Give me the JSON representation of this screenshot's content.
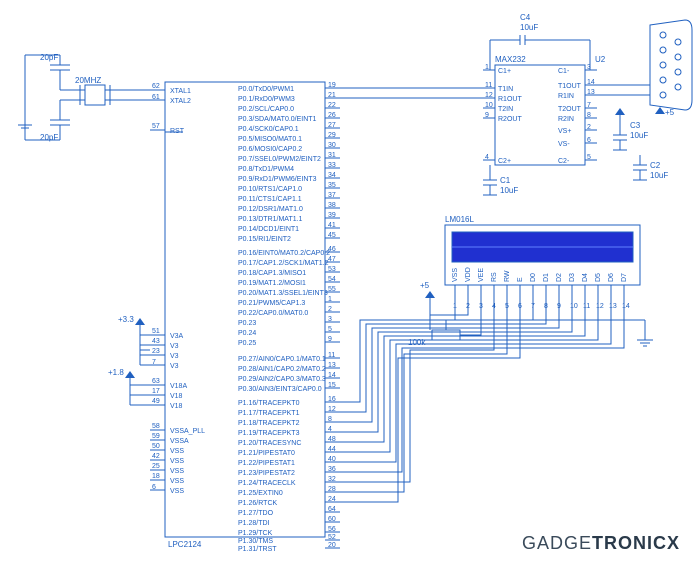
{
  "mcu": {
    "name": "LPC2124",
    "left_pins": [
      {
        "n": "62",
        "lbl": "XTAL1"
      },
      {
        "n": "61",
        "lbl": "XTAL2"
      },
      {
        "n": "57",
        "lbl": "RST"
      },
      {
        "n": "51",
        "lbl": "V3A"
      },
      {
        "n": "43",
        "lbl": "V3"
      },
      {
        "n": "23",
        "lbl": "V3"
      },
      {
        "n": "7",
        "lbl": "V3"
      },
      {
        "n": "63",
        "lbl": "V18A"
      },
      {
        "n": "17",
        "lbl": "V18"
      },
      {
        "n": "49",
        "lbl": "V18"
      },
      {
        "n": "58",
        "lbl": "VSSA_PLL"
      },
      {
        "n": "59",
        "lbl": "VSSA"
      },
      {
        "n": "50",
        "lbl": "VSS"
      },
      {
        "n": "42",
        "lbl": "VSS"
      },
      {
        "n": "25",
        "lbl": "VSS"
      },
      {
        "n": "18",
        "lbl": "VSS"
      },
      {
        "n": "6",
        "lbl": "VSS"
      }
    ],
    "right_pins": [
      {
        "n": "19",
        "lbl": "P0.0/TxD0/PWM1"
      },
      {
        "n": "21",
        "lbl": "P0.1/RxD0/PWM3"
      },
      {
        "n": "22",
        "lbl": "P0.2/SCL/CAP0.0"
      },
      {
        "n": "26",
        "lbl": "P0.3/SDA/MAT0.0/EINT1"
      },
      {
        "n": "27",
        "lbl": "P0.4/SCK0/CAP0.1"
      },
      {
        "n": "29",
        "lbl": "P0.5/MISO0/MAT0.1"
      },
      {
        "n": "30",
        "lbl": "P0.6/MOSI0/CAP0.2"
      },
      {
        "n": "31",
        "lbl": "P0.7/SSEL0/PWM2/EINT2"
      },
      {
        "n": "33",
        "lbl": "P0.8/TxD1/PWM4"
      },
      {
        "n": "34",
        "lbl": "P0.9/RxD1/PWM6/EINT3"
      },
      {
        "n": "35",
        "lbl": "P0.10/RTS1/CAP1.0"
      },
      {
        "n": "37",
        "lbl": "P0.11/CTS1/CAP1.1"
      },
      {
        "n": "38",
        "lbl": "P0.12/DSR1/MAT1.0"
      },
      {
        "n": "39",
        "lbl": "P0.13/DTR1/MAT1.1"
      },
      {
        "n": "41",
        "lbl": "P0.14/DCD1/EINT1"
      },
      {
        "n": "45",
        "lbl": "P0.15/RI1/EINT2"
      },
      {
        "n": "46",
        "lbl": "P0.16/EINT0/MAT0.2/CAP0.2"
      },
      {
        "n": "47",
        "lbl": "P0.17/CAP1.2/SCK1/MAT1.2"
      },
      {
        "n": "53",
        "lbl": "P0.18/CAP1.3/MISO1"
      },
      {
        "n": "54",
        "lbl": "P0.19/MAT1.2/MOSI1"
      },
      {
        "n": "55",
        "lbl": "P0.20/MAT1.3/SSEL1/EINT3"
      },
      {
        "n": "1",
        "lbl": "P0.21/PWM5/CAP1.3"
      },
      {
        "n": "2",
        "lbl": "P0.22/CAP0.0/MAT0.0"
      },
      {
        "n": "3",
        "lbl": "P0.23"
      },
      {
        "n": "5",
        "lbl": "P0.24"
      },
      {
        "n": "9",
        "lbl": "P0.25"
      },
      {
        "n": "11",
        "lbl": "P0.27/AIN0/CAP0.1/MAT0.1"
      },
      {
        "n": "13",
        "lbl": "P0.28/AIN1/CAP0.2/MAT0.2"
      },
      {
        "n": "14",
        "lbl": "P0.29/AIN2/CAP0.3/MAT0.3"
      },
      {
        "n": "15",
        "lbl": "P0.30/AIN3/EINT3/CAP0.0"
      },
      {
        "n": "16",
        "lbl": "P1.16/TRACEPKT0"
      },
      {
        "n": "12",
        "lbl": "P1.17/TRACEPKT1"
      },
      {
        "n": "8",
        "lbl": "P1.18/TRACEPKT2"
      },
      {
        "n": "4",
        "lbl": "P1.19/TRACEPKT3"
      },
      {
        "n": "48",
        "lbl": "P1.20/TRACESYNC"
      },
      {
        "n": "44",
        "lbl": "P1.21/PIPESTAT0"
      },
      {
        "n": "40",
        "lbl": "P1.22/PIPESTAT1"
      },
      {
        "n": "36",
        "lbl": "P1.23/PIPESTAT2"
      },
      {
        "n": "32",
        "lbl": "P1.24/TRACECLK"
      },
      {
        "n": "28",
        "lbl": "P1.25/EXTIN0"
      },
      {
        "n": "24",
        "lbl": "P1.26/RTCK"
      },
      {
        "n": "64",
        "lbl": "P1.27/TDO"
      },
      {
        "n": "60",
        "lbl": "P1.28/TDI"
      },
      {
        "n": "56",
        "lbl": "P1.29/TCK"
      },
      {
        "n": "52",
        "lbl": "P1.30/TMS"
      },
      {
        "n": "20",
        "lbl": "P1.31/TRST"
      }
    ]
  },
  "max232": {
    "name": "MAX232",
    "ref": "U2",
    "left_pins": [
      {
        "n": "1",
        "lbl": "C1+"
      },
      {
        "n": "11",
        "lbl": "T1IN"
      },
      {
        "n": "12",
        "lbl": "R1OUT"
      },
      {
        "n": "10",
        "lbl": "T2IN"
      },
      {
        "n": "9",
        "lbl": "R2OUT"
      },
      {
        "n": "4",
        "lbl": "C2+"
      }
    ],
    "right_pins": [
      {
        "n": "3",
        "lbl": "C1-"
      },
      {
        "n": "14",
        "lbl": "T1OUT"
      },
      {
        "n": "13",
        "lbl": "R1IN"
      },
      {
        "n": "7",
        "lbl": "T2OUT"
      },
      {
        "n": "8",
        "lbl": "R2IN"
      },
      {
        "n": "2",
        "lbl": "VS+"
      },
      {
        "n": "6",
        "lbl": "VS-"
      },
      {
        "n": "5",
        "lbl": "C2-"
      }
    ]
  },
  "lcd": {
    "name": "LM016L",
    "pins": [
      "VSS",
      "VDD",
      "VEE",
      "RS",
      "RW",
      "E",
      "D0",
      "D1",
      "D2",
      "D3",
      "D4",
      "D5",
      "D6",
      "D7"
    ],
    "pin_nums": [
      "1",
      "2",
      "3",
      "4",
      "5",
      "6",
      "7",
      "8",
      "9",
      "10",
      "11",
      "12",
      "13",
      "14"
    ]
  },
  "caps": {
    "c1": {
      "ref": "C1",
      "val": "10uF"
    },
    "c2": {
      "ref": "C2",
      "val": "10uF"
    },
    "c3": {
      "ref": "C3",
      "val": "10uF"
    },
    "c4": {
      "ref": "C4",
      "val": "10uF"
    },
    "xtal_c1": "20pF",
    "xtal_c2": "20pF"
  },
  "xtal": "20MHZ",
  "resistor": "100k",
  "supplies": {
    "v33": "+3.3",
    "v18": "+1.8",
    "v5": "+5"
  },
  "watermark": {
    "a": "GADGE",
    "b": "TRONICX"
  }
}
